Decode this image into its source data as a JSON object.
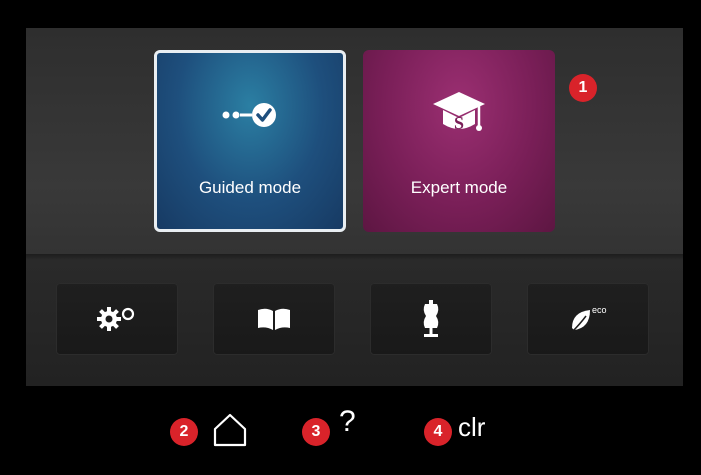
{
  "modes": {
    "guided": {
      "label": "Guided mode",
      "icon": "guided-steps-icon",
      "color": "#1e4f7d",
      "selected": true
    },
    "expert": {
      "label": "Expert mode",
      "icon": "graduation-cap-icon",
      "color": "#7a1f58"
    }
  },
  "toolbar": [
    {
      "name": "settings",
      "icon": "gears-icon"
    },
    {
      "name": "tutorial",
      "icon": "open-book-icon"
    },
    {
      "name": "creative-consultant",
      "icon": "dress-form-icon"
    },
    {
      "name": "eco",
      "icon": "eco-leaf-icon",
      "icon_text": "eco"
    }
  ],
  "callouts": {
    "c1": "1",
    "c2": "2",
    "c3": "3",
    "c4": "4"
  },
  "bottom_bar": {
    "home_icon": "home-icon",
    "help_label": "?",
    "clear_label": "clr"
  },
  "colors": {
    "callout": "#d9232a",
    "background": "#000000"
  }
}
